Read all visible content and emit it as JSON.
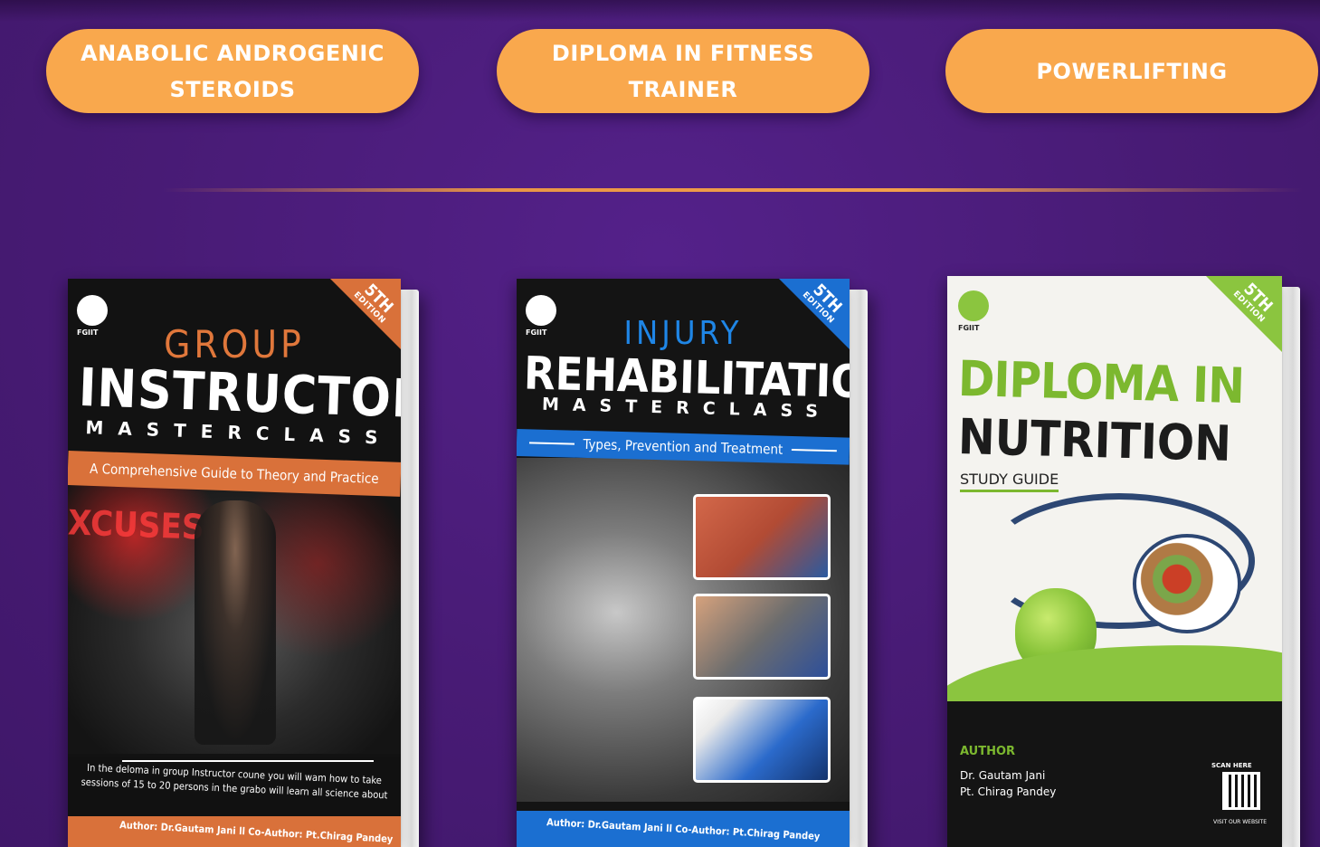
{
  "categories": [
    {
      "line1": "ANABOLIC ANDROGENIC",
      "line2": "STEROIDS"
    },
    {
      "line1": "DIPLOMA IN FITNESS",
      "line2": "TRAINER"
    },
    {
      "line1": "POWERLIFTING",
      "line2": ""
    }
  ],
  "books": [
    {
      "logo": "FGIIT",
      "edition_num": "5TH",
      "edition_word": "EDITION",
      "title_top": "GROUP",
      "title_main": "INSTRUCTOR",
      "title_sub": "MASTERCLASS",
      "band": "A Comprehensive Guide to Theory and Practice",
      "photo_text": "XCUSES",
      "description_1": "In the deloma in group Instructor coune you will wam how to take",
      "description_2": "sessions of 15 to 20 persons in the grabo will learn all science about",
      "authors": "Author: Dr.Gautam Jani  ll Co-Author: Pt.Chirag Pandey",
      "accent": "#d9713a"
    },
    {
      "logo": "FGIIT",
      "edition_num": "5TH",
      "edition_word": "EDITION",
      "title_top": "INJURY",
      "title_main": "REHABILITATION",
      "title_sub": "MASTERCLASS",
      "band": "Types, Prevention and Treatment",
      "authors": "Author: Dr.Gautam Jani  ll Co-Author: Pt.Chirag Pandey",
      "accent": "#1b6fd1"
    },
    {
      "logo": "FGIIT",
      "edition_num": "5TH",
      "edition_word": "EDITION",
      "title_line1": "DIPLOMA IN",
      "title_line2": "NUTRITION",
      "subtitle": "STUDY GUIDE",
      "author_heading": "AUTHOR",
      "author_1": "Dr. Gautam Jani",
      "author_2": "Pt. Chirag Pandey",
      "scan_label": "SCAN HERE",
      "visit_label": "VISIT OUR WEBSITE",
      "accent": "#7cb82f"
    }
  ],
  "colors": {
    "background": "#4a1c78",
    "pill": "#f9a84d",
    "divider": "#e99645"
  }
}
